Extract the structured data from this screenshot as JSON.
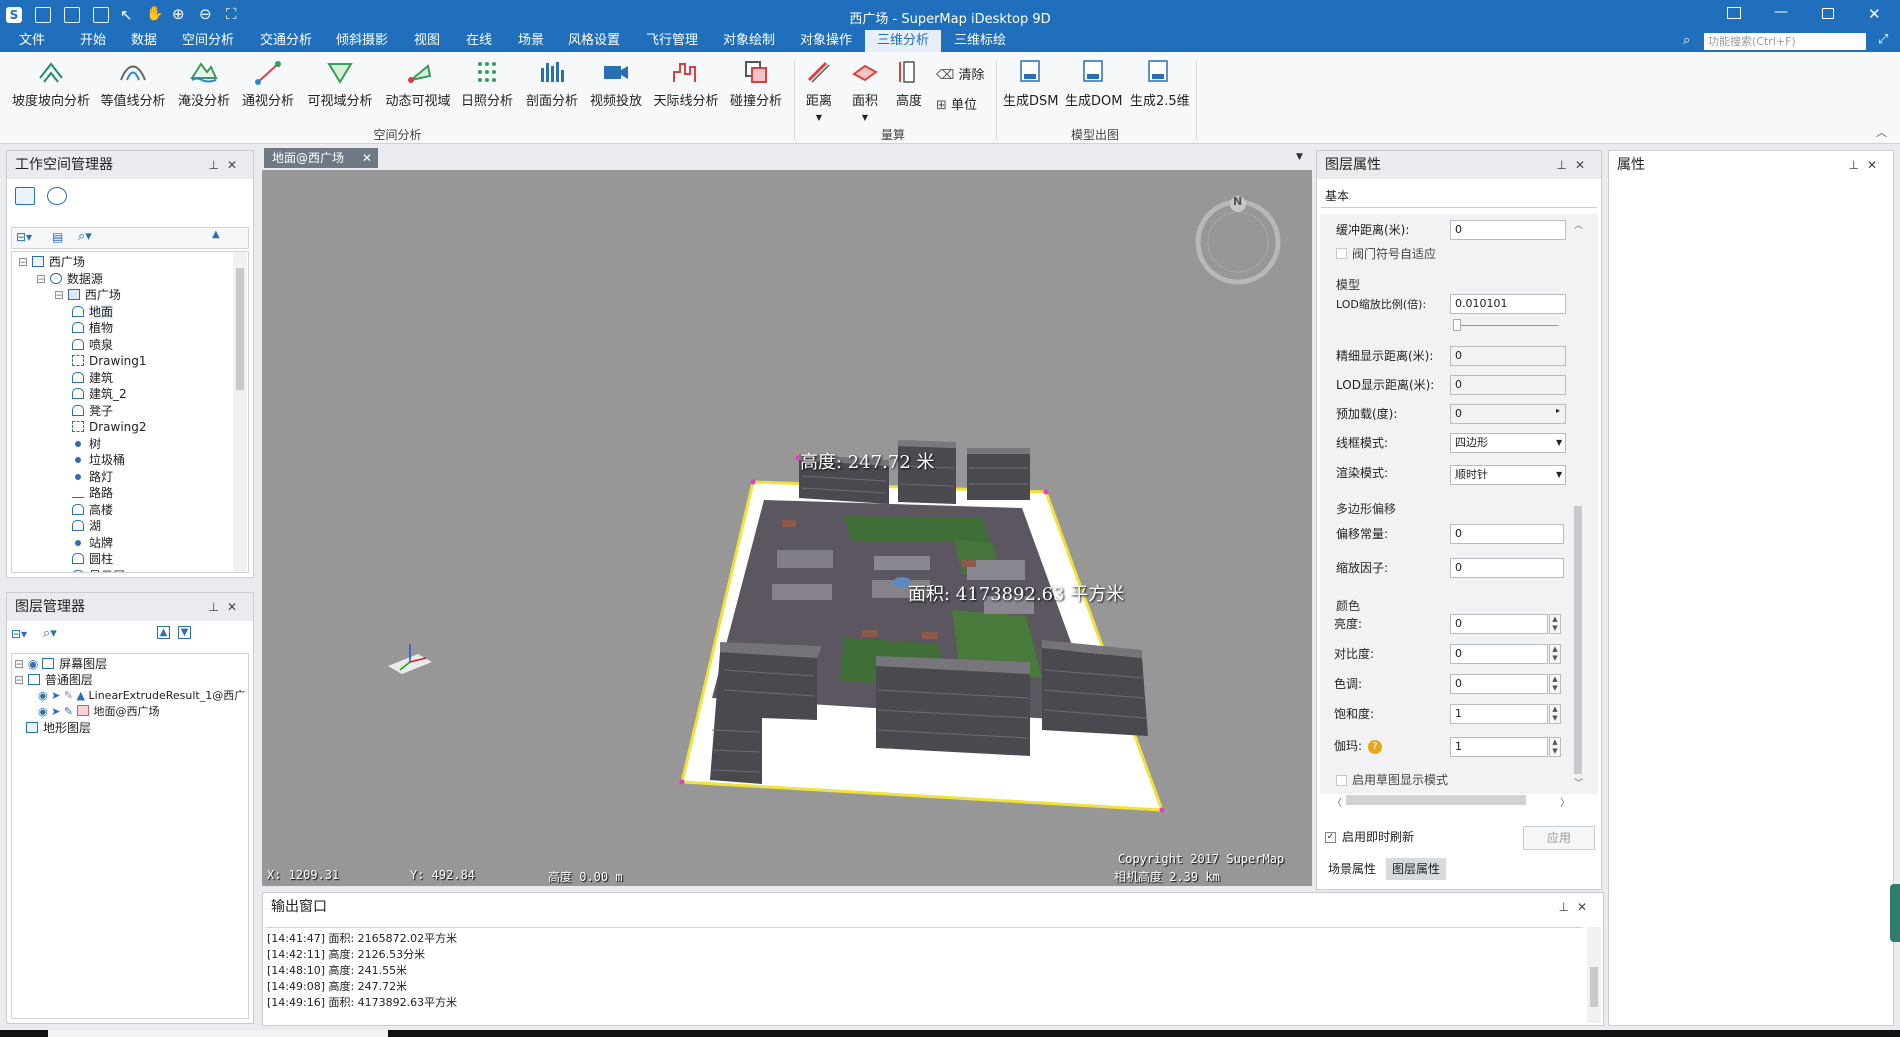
{
  "window": {
    "title": "西广场 - SuperMap iDesktop 9D"
  },
  "menu": {
    "items": [
      "文件",
      "开始",
      "数据",
      "空间分析",
      "交通分析",
      "倾斜摄影",
      "视图",
      "在线",
      "场景",
      "风格设置",
      "飞行管理",
      "对象绘制",
      "对象操作",
      "三维分析",
      "三维标绘"
    ],
    "active": "三维分析",
    "search_placeholder": "功能搜索(Ctrl+F)"
  },
  "ribbon": {
    "spatial": [
      "坡度坡向分析",
      "等值线分析",
      "淹没分析",
      "通视分析",
      "可视域分析",
      "动态可视域",
      "日照分析",
      "剖面分析",
      "视频投放",
      "天际线分析",
      "碰撞分析"
    ],
    "spatial_label": "空间分析",
    "measure": {
      "distance": "距离",
      "area": "面积",
      "height": "高度",
      "clear": "清除",
      "unit": "单位",
      "label": "量算"
    },
    "output": {
      "items": [
        "生成DSM",
        "生成DOM",
        "生成2.5维"
      ],
      "label": "模型出图"
    }
  },
  "workspace": {
    "title": "工作空间管理器",
    "tree": [
      {
        "label": "西广场",
        "icon": "workspace-icon",
        "indent": 0
      },
      {
        "label": "数据源",
        "icon": "datasource-icon",
        "indent": 1
      },
      {
        "label": "西广场",
        "icon": "database-icon",
        "indent": 2
      },
      {
        "label": "地面",
        "icon": "region-icon",
        "indent": 3
      },
      {
        "label": "植物",
        "icon": "region-icon",
        "indent": 3
      },
      {
        "label": "喷泉",
        "icon": "region-icon",
        "indent": 3
      },
      {
        "label": "Drawing1",
        "icon": "cad-icon",
        "indent": 3
      },
      {
        "label": "建筑",
        "icon": "region-icon",
        "indent": 3
      },
      {
        "label": "建筑_2",
        "icon": "region-icon",
        "indent": 3
      },
      {
        "label": "凳子",
        "icon": "region-icon",
        "indent": 3
      },
      {
        "label": "Drawing2",
        "icon": "cad-icon",
        "indent": 3
      },
      {
        "label": "树",
        "icon": "point-icon",
        "indent": 3
      },
      {
        "label": "垃圾桶",
        "icon": "point-icon",
        "indent": 3
      },
      {
        "label": "路灯",
        "icon": "point-icon",
        "indent": 3
      },
      {
        "label": "路路",
        "icon": "line-icon",
        "indent": 3
      },
      {
        "label": "高楼",
        "icon": "region-icon",
        "indent": 3
      },
      {
        "label": "湖",
        "icon": "region-icon",
        "indent": 3
      },
      {
        "label": "站牌",
        "icon": "point-icon",
        "indent": 3
      },
      {
        "label": "圆柱",
        "icon": "region-icon",
        "indent": 3
      },
      {
        "label": "显示屏",
        "icon": "region-icon",
        "indent": 3
      }
    ]
  },
  "layers": {
    "title": "图层管理器",
    "items": [
      {
        "label": "屏幕图层",
        "indent": 0
      },
      {
        "label": "普通图层",
        "indent": 0
      },
      {
        "label": "LinearExtrudeResult_1@西广",
        "indent": 1
      },
      {
        "label": "地面@西广场",
        "indent": 1
      },
      {
        "label": "地形图层",
        "indent": 0
      }
    ]
  },
  "scene": {
    "tab": "地面@西广场",
    "height_label": "高度: 247.72 米",
    "area_label": "面积: 4173892.63 平方米",
    "compass_n": "N",
    "status_x": "X: 1209.31",
    "status_y": "Y: 492.84",
    "status_alt": "高度 0.00 m",
    "copyright": "Copyright 2017 SuperMap",
    "camera_alt": "相机高度 2.39 km"
  },
  "layer_props": {
    "title": "图层属性",
    "tab": "基本",
    "buffer_label": "缓冲距离(米):",
    "buffer_value": "0",
    "valve_label": "阀门符号自适应",
    "model_section": "模型",
    "lod_label": "LOD缩放比例(倍):",
    "lod_value": "0.010101",
    "fine_label": "精细显示距离(米):",
    "fine_value": "0",
    "lod_dist_label": "LOD显示距离(米):",
    "lod_dist_value": "0",
    "preload_label": "预加载(度):",
    "preload_value": "0",
    "wire_label": "线框模式:",
    "wire_value": "四边形",
    "render_label": "渲染模式:",
    "render_value": "顺时针",
    "poly_section": "多边形偏移",
    "offset_label": "偏移常量:",
    "offset_value": "0",
    "scale_label": "缩放因子:",
    "scale_value": "0",
    "color_section": "颜色",
    "brightness_label": "亮度:",
    "brightness_value": "0",
    "contrast_label": "对比度:",
    "contrast_value": "0",
    "hue_label": "色调:",
    "hue_value": "0",
    "saturation_label": "饱和度:",
    "saturation_value": "1",
    "gamma_label": "伽玛:",
    "gamma_value": "1",
    "sketch_label": "启用草图显示模式",
    "realtime_label": "启用即时刷新",
    "apply": "应用",
    "bottom_tabs": [
      "场景属性",
      "图层属性"
    ]
  },
  "attrs": {
    "title": "属性"
  },
  "output": {
    "title": "输出窗口",
    "lines": [
      "[14:41:47] 面积: 2165872.02平方米",
      "[14:42:11] 高度: 2126.53分米",
      "[14:48:10] 高度: 241.55米",
      "[14:49:08] 高度: 247.72米",
      "[14:49:16] 面积: 4173892.63平方米"
    ]
  },
  "colors": {
    "title_bg": "#1f6fbd",
    "accent": "#1f6fbd",
    "scene_bg": "#979797",
    "slab": "#ffffff",
    "edge": "#f0e23a"
  }
}
